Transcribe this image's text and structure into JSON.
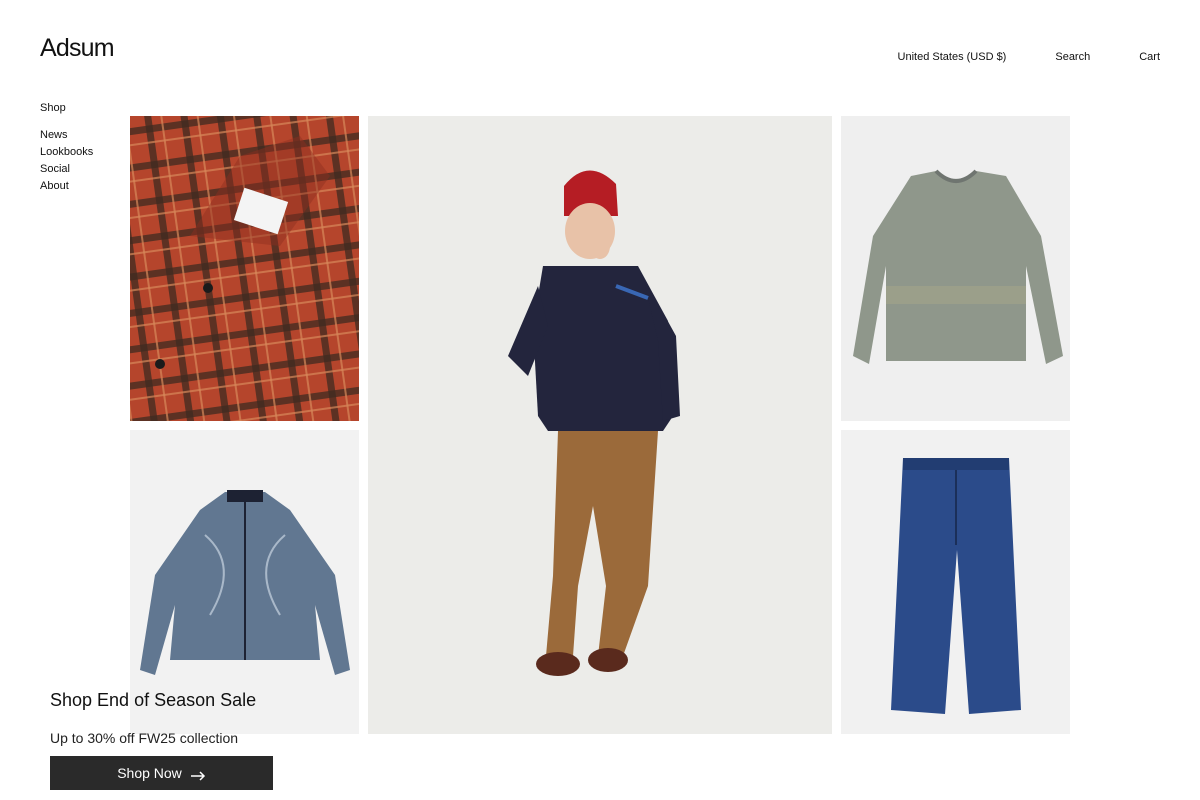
{
  "header": {
    "logo": "Adsum",
    "region": "United States (USD $)",
    "search": "Search",
    "cart": "Cart"
  },
  "sidebar": {
    "shop": "Shop",
    "items": [
      {
        "label": "News"
      },
      {
        "label": "Lookbooks"
      },
      {
        "label": "Social"
      },
      {
        "label": "About"
      }
    ]
  },
  "grid": {
    "tiles": [
      {
        "name": "plaid-shirt"
      },
      {
        "name": "model-look"
      },
      {
        "name": "grey-sweater"
      },
      {
        "name": "fleece-jacket"
      },
      {
        "name": "denim-jeans"
      }
    ]
  },
  "promo": {
    "title": "Shop End of Season Sale",
    "subtitle": "Up to 30% off FW25 collection",
    "button": "Shop Now",
    "button_icon": "arrow-right-icon"
  },
  "colors": {
    "button_bg": "#2a2a2a",
    "text": "#111111"
  }
}
